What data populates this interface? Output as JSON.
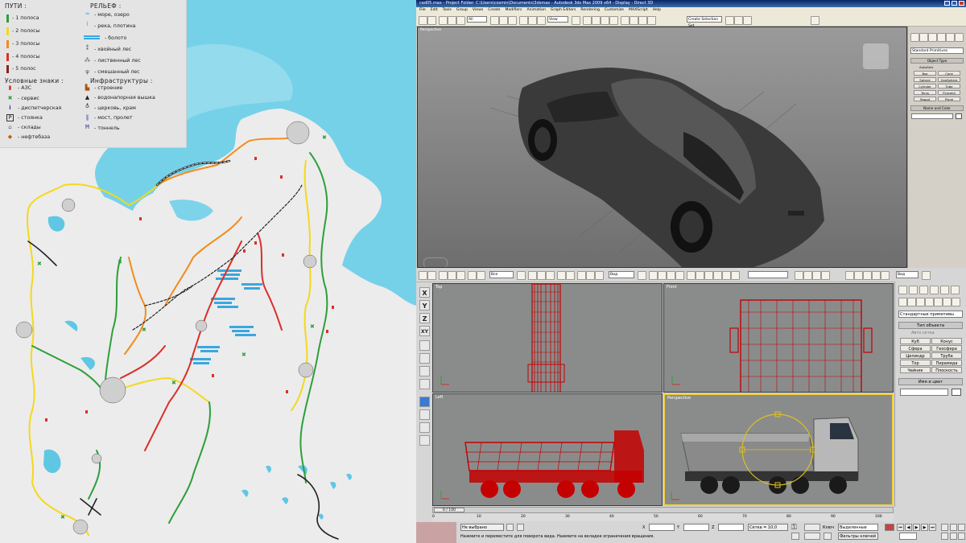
{
  "map": {
    "legend": {
      "roads_title": "ПУТИ :",
      "roads": [
        {
          "label": "- 1 полоса",
          "color": "#2e9e3a"
        },
        {
          "label": "- 2 полосы",
          "color": "#f4d81e"
        },
        {
          "label": "- 3 полосы",
          "color": "#f28c1c"
        },
        {
          "label": "- 4 полосы",
          "color": "#d9302a"
        },
        {
          "label": "- 5 полос",
          "color": "#8a2020"
        }
      ],
      "relief_title": "РЕЛЬЕФ :",
      "relief": [
        {
          "label": "- море, озеро",
          "icon": "sea-icon"
        },
        {
          "label": "- река, плотина",
          "icon": "river-icon"
        },
        {
          "label": "- болото",
          "icon": "swamp-icon"
        },
        {
          "label": "- хвойный лес",
          "icon": "conifer-icon"
        },
        {
          "label": "- лиственный лес",
          "icon": "deciduous-icon"
        },
        {
          "label": "- смешанный лес",
          "icon": "mixed-forest-icon"
        }
      ],
      "signs_title": "Условные знаки :",
      "signs": [
        {
          "label": "- АЗС",
          "icon": "fuel-icon"
        },
        {
          "label": "- сервис",
          "icon": "service-icon"
        },
        {
          "label": "- диспетчерская",
          "icon": "dispatch-icon"
        },
        {
          "label": "- стоянка",
          "icon": "parking-icon"
        },
        {
          "label": "- склады",
          "icon": "warehouse-icon"
        },
        {
          "label": "- нефтебаза",
          "icon": "oil-depot-icon"
        }
      ],
      "infra_title": "Инфраструктуры :",
      "infra": [
        {
          "label": "- строение",
          "icon": "building-icon"
        },
        {
          "label": "- водонапорная вышка",
          "icon": "water-tower-icon"
        },
        {
          "label": "- церковь, храм",
          "icon": "church-icon"
        },
        {
          "label": "- мост, пролет",
          "icon": "bridge-icon"
        },
        {
          "label": "- тоннель",
          "icon": "tunnel-icon"
        }
      ]
    }
  },
  "max_top": {
    "title": "cad05.max - Project Folder: C:\\Users\\cosmin\\Documents\\3dsmax - Autodesk 3ds Max 2009 x64 - Display : Direct 3D",
    "menu": [
      "File",
      "Edit",
      "Tools",
      "Group",
      "Views",
      "Create",
      "Modifiers",
      "Animation",
      "Graph Editors",
      "Rendering",
      "Customize",
      "MAXScript",
      "Help"
    ],
    "filter_value": "All",
    "view_value": "View",
    "selection_set": "Create Selection Set",
    "viewport_label": "Perspective",
    "panel": {
      "dropdown": "Standard Primitives",
      "rollout_object_type": "Object Type",
      "autogrid": "AutoGrid",
      "buttons": [
        "Box",
        "Cone",
        "Sphere",
        "GeoSphere",
        "Cylinder",
        "Tube",
        "Torus",
        "Pyramid",
        "Teapot",
        "Plane"
      ],
      "rollout_name_color": "Name and Color"
    }
  },
  "max_bottom": {
    "filter_value": "Все",
    "view_value": "Вид",
    "view_value_2": "Вид",
    "viewports": [
      {
        "label": "Top"
      },
      {
        "label": "Front"
      },
      {
        "label": "Left"
      },
      {
        "label": "Perspective"
      }
    ],
    "left_tools": [
      "X",
      "Y",
      "Z",
      "XY"
    ],
    "panel": {
      "dropdown": "Стандартные примитивы",
      "rollout_object_type": "Тип объекта",
      "autogrid": "Авто сетка",
      "buttons": [
        "Куб",
        "Конус",
        "Сфера",
        "Геосфера",
        "Цилиндр",
        "Труба",
        "Тор",
        "Пирамида",
        "Чайник",
        "Плоскость"
      ],
      "rollout_name_color": "Имя и цвет"
    },
    "timeline": "0 / 100",
    "ruler": [
      "0",
      "10",
      "20",
      "30",
      "40",
      "50",
      "60",
      "70",
      "80",
      "90",
      "100"
    ],
    "status": {
      "selection": "Не выбрано",
      "prompt": "Нажмите и переместите для поворота вида. Нажмите на вкладке ограничения вращения.",
      "x_label": "X",
      "y_label": "Y",
      "z_label": "Z",
      "grid": "Сетка = 10,0",
      "key_mode": "Ключ",
      "selected": "Выделенные",
      "key_filters": "Фильтры ключей"
    }
  }
}
